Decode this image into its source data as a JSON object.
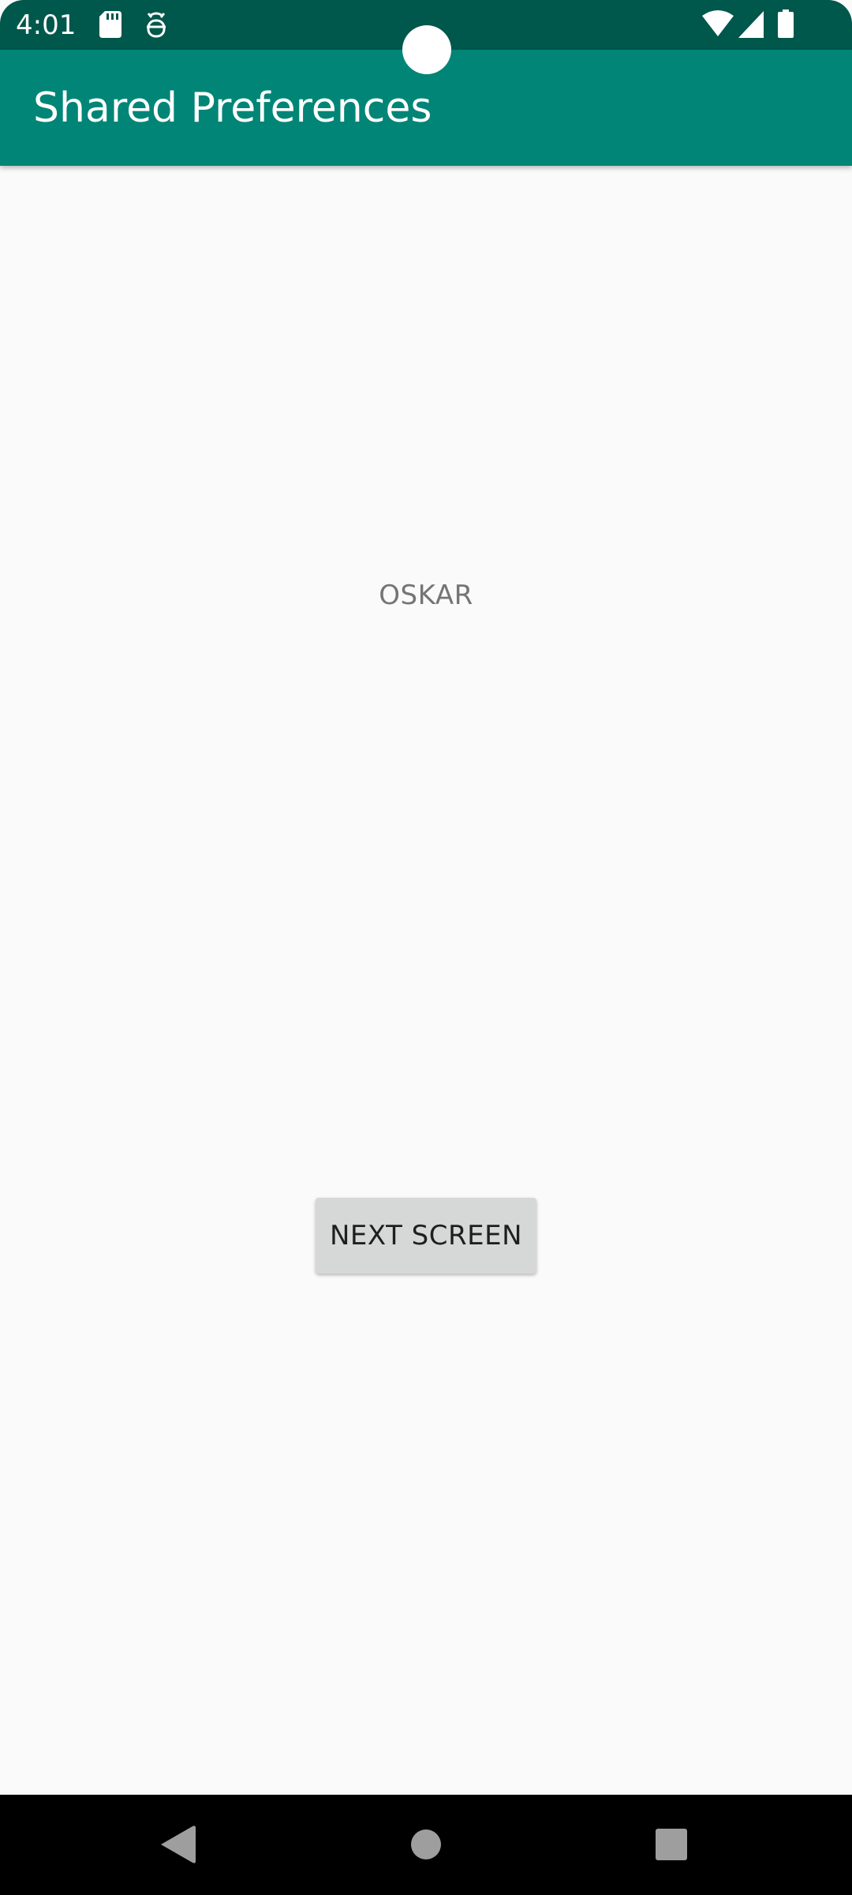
{
  "status_bar": {
    "time": "4:01",
    "icons": [
      "sd-card-icon",
      "debug-icon",
      "wifi-icon",
      "signal-icon",
      "battery-icon"
    ]
  },
  "app_bar": {
    "title": "Shared Preferences"
  },
  "main": {
    "name_text": "OSKAR",
    "next_button_label": "NEXT SCREEN"
  },
  "nav_bar": {
    "icons": [
      "back-icon",
      "home-icon",
      "recents-icon"
    ]
  },
  "colors": {
    "status_bar": "#00574b",
    "app_bar": "#008577",
    "background": "#fafafa",
    "button": "#d6d7d7",
    "name_text": "#757575"
  }
}
